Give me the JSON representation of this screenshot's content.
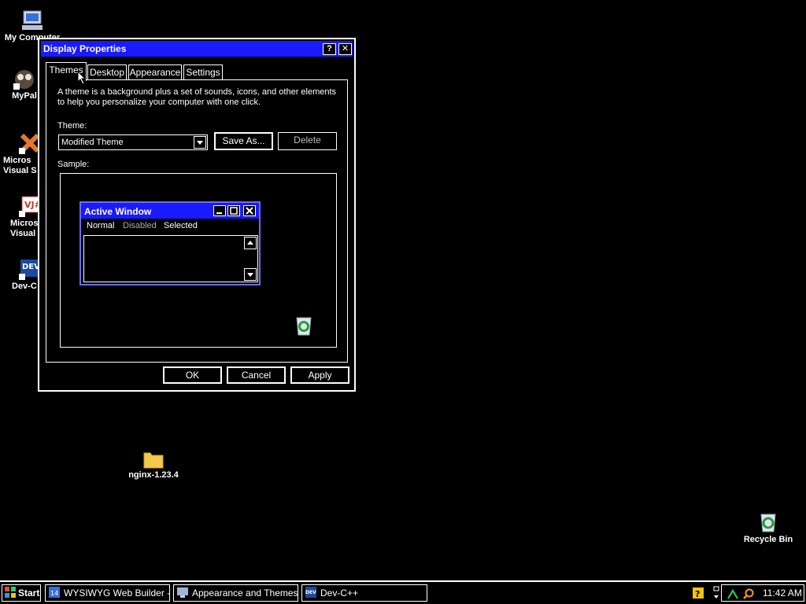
{
  "desktop": {
    "icons": [
      {
        "name": "my-computer",
        "label": "My Computer"
      },
      {
        "name": "mypal",
        "label": "MyPal"
      },
      {
        "name": "visual-studio",
        "label": "Micros\nVisual S"
      },
      {
        "name": "visual-jsharp",
        "label": "Micros\nVisual"
      },
      {
        "name": "dev-cpp",
        "label": "Dev-C"
      },
      {
        "name": "nginx-folder",
        "label": "nginx-1.23.4"
      },
      {
        "name": "recycle-bin",
        "label": "Recycle Bin"
      }
    ]
  },
  "dialog": {
    "title": "Display Properties",
    "help_label": "?",
    "close_label": "✕",
    "tabs": [
      {
        "label": "Themes"
      },
      {
        "label": "Desktop"
      },
      {
        "label": "Appearance"
      },
      {
        "label": "Settings"
      }
    ],
    "description": "A theme is a background plus a set of sounds, icons, and other elements to help you personalize your computer with one click.",
    "theme_label": "Theme:",
    "theme_value": "Modified Theme",
    "save_as_label": "Save As...",
    "delete_label": "Delete",
    "sample_label": "Sample:",
    "sample_window": {
      "title": "Active Window",
      "menu": [
        "Normal",
        "Disabled",
        "Selected"
      ]
    },
    "ok_label": "OK",
    "cancel_label": "Cancel",
    "apply_label": "Apply"
  },
  "taskbar": {
    "start_label": "Start",
    "items": [
      {
        "label": "WYSIWYG Web Builder -..."
      },
      {
        "label": "Appearance and Themes"
      },
      {
        "label": "Dev-C++"
      }
    ],
    "clock": "11:42 AM"
  },
  "colors": {
    "titlebar": "#1a1aff",
    "background": "#000000",
    "text": "#ffffff"
  }
}
